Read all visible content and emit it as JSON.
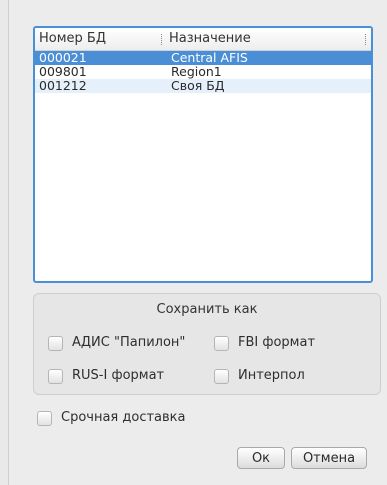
{
  "table": {
    "columns": [
      "Номер БД",
      "Назначение"
    ],
    "rows": [
      {
        "number": "000021",
        "purpose": "Central AFIS",
        "selected": true
      },
      {
        "number": "009801",
        "purpose": "Region1",
        "selected": false
      },
      {
        "number": "001212",
        "purpose": "Своя БД",
        "selected": false
      }
    ]
  },
  "save_group": {
    "title": "Сохранить как",
    "options": [
      {
        "label": "АДИС \"Папилон\"",
        "checked": false
      },
      {
        "label": "FBI формат",
        "checked": false
      },
      {
        "label": "RUS-I формат",
        "checked": false
      },
      {
        "label": "Интерпол",
        "checked": false
      }
    ]
  },
  "urgent": {
    "label": "Срочная доставка",
    "checked": false
  },
  "buttons": {
    "ok": "Ок",
    "cancel": "Отмена"
  }
}
